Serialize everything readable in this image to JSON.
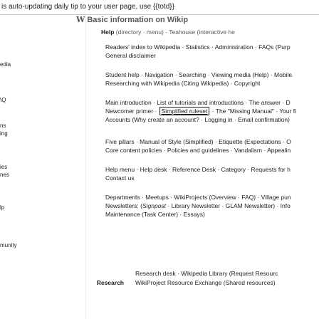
{
  "topbar": {
    "title": "is auto-updating daily tip to your user page, use {{totd}}"
  },
  "sidebar": {
    "labels": [
      "edia",
      "\\Q",
      "ns",
      "ing",
      "ies",
      "nes",
      "lp",
      "munity"
    ]
  },
  "header": {
    "logo_glyph": "W",
    "title": "Basic information on Wikip",
    "help_label": "Help",
    "help_rest": "(directory · menu) · Teahouse (interactive he"
  },
  "sections": [
    {
      "lines": [
        "Readers' index to Wikipedia · Statistics · Administration · FAQs (Purp",
        "General disclaimer"
      ]
    },
    {
      "lines": [
        "Student help · Navigation · Searching · Viewing media (Help) · Mobile",
        "Researching with Wikipedia (Citing Wikipedia) · Copyright"
      ]
    },
    {
      "line1": "Main introduction · List of tutorials and introductions · The answer · D",
      "line2_before": "Newcomer primer · ",
      "line2_boxed": "Simplified ruleset",
      "line2_after": " · The \"Missing Manual\" · Your fi",
      "line3": "Accounts (Why create an account? · Logging in · Email confirmation)"
    },
    {
      "lines": [
        "Five pillars · Manual of Style (Simplified) · Etiquette (Expectations · O",
        "Core content policies · Policies and guidelines · Vandalism · Appealin"
      ]
    },
    {
      "lines": [
        "Help menu · Help desk · Reference Desk · Category · Requests for h",
        "Contact us"
      ]
    },
    {
      "line1": "Departments · Meetups · WikiProjects (Overview · FAQ) · Village pun",
      "line2_before": "Newsletters: (",
      "line2_italic": "Signpost",
      "line2_after": " · Library Newsletter · GLAM Newsletter) · Info",
      "line3": "Maintenance (Task Center) · Essays)"
    }
  ],
  "footer": {
    "label": "Research",
    "lines": [
      "Research desk · Wikipedia Library (Request Resourc",
      "WikiProject Resource Exchange (Shared resources)"
    ]
  }
}
